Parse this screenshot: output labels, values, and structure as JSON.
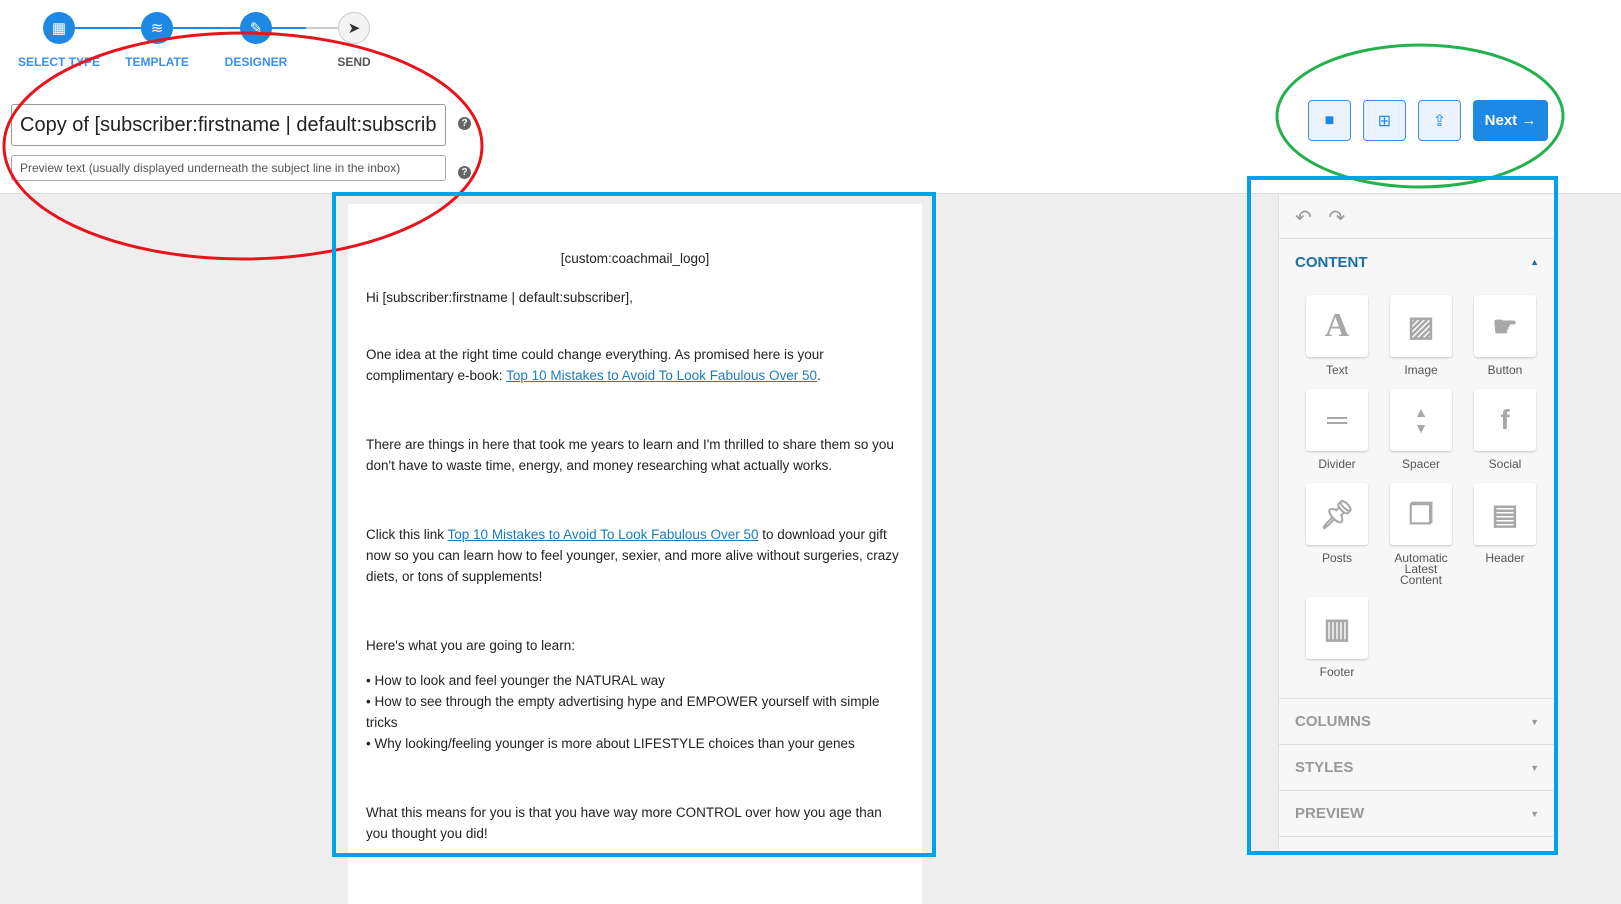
{
  "steps": [
    {
      "label": "SELECT TYPE",
      "icon": "grid-icon",
      "state": "done"
    },
    {
      "label": "TEMPLATE",
      "icon": "layers-icon",
      "state": "done"
    },
    {
      "label": "DESIGNER",
      "icon": "edit-icon",
      "state": "active"
    },
    {
      "label": "SEND",
      "icon": "send-icon",
      "state": "pending"
    }
  ],
  "subject": {
    "value": "Copy of [subscriber:firstname | default:subscriber], here's your free e-book"
  },
  "preview": {
    "placeholder": "Preview text (usually displayed underneath the subject line in the inbox)"
  },
  "toolbar": {
    "save_icon": "file-icon",
    "new_icon": "file-plus-icon",
    "export_icon": "share-icon",
    "next_label": "Next",
    "accent": "#1e88e5"
  },
  "email": {
    "logo": "[custom:coachmail_logo]",
    "greeting": "Hi [subscriber:firstname | default:subscriber],",
    "p1": "One idea at the right time could change everything. As promised here is your complimentary e-book: ",
    "p1_link": "Top 10 Mistakes to Avoid To Look Fabulous Over 50",
    "p1_end": ".",
    "p2": "There are things in here that took me years to learn and I'm thrilled to share them so you don't have to waste time, energy, and money researching what actually works.",
    "p3_start": "Click this link ",
    "p3_link": "Top 10 Mistakes to Avoid To Look Fabulous Over 50",
    "p3_end": " to download your gift now so you can learn how to feel younger, sexier, and more alive without surgeries, crazy diets, or tons of supplements!",
    "p4": "Here's what you are going to learn:",
    "bullets": [
      "• How to look and feel younger the NATURAL way",
      "• How to see through the empty advertising hype and EMPOWER yourself with simple tricks",
      "• Why looking/feeling younger is more about LIFESTYLE choices than your genes"
    ],
    "p5": "What this means for you is that you have way more CONTROL over how you age than you thought you did!"
  },
  "panel": {
    "content_title": "CONTENT",
    "blocks": [
      {
        "label": "Text",
        "icon": "text-icon"
      },
      {
        "label": "Image",
        "icon": "image-icon"
      },
      {
        "label": "Button",
        "icon": "button-icon"
      },
      {
        "label": "Divider",
        "icon": "divider-icon"
      },
      {
        "label": "Spacer",
        "icon": "spacer-icon"
      },
      {
        "label": "Social",
        "icon": "facebook-icon"
      },
      {
        "label": "Posts",
        "icon": "pin-icon"
      },
      {
        "label": "Automatic Latest Content",
        "icon": "pin-stack-icon"
      },
      {
        "label": "Header",
        "icon": "header-icon"
      },
      {
        "label": "Footer",
        "icon": "footer-icon"
      }
    ],
    "sections": [
      "COLUMNS",
      "STYLES",
      "PREVIEW"
    ]
  }
}
